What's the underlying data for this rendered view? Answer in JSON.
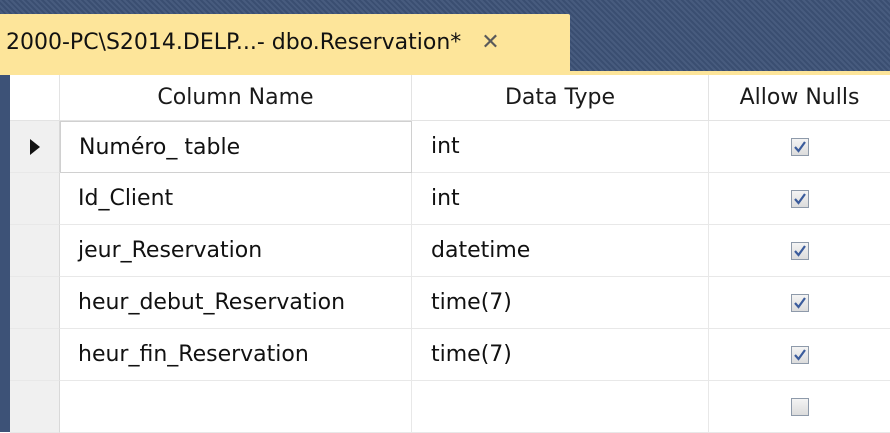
{
  "tab": {
    "title": "2000-PC\\S2014.DELP...- dbo.Reservation*",
    "close_glyph": "✕"
  },
  "columns": {
    "name": "Column Name",
    "type": "Data Type",
    "nulls": "Allow Nulls"
  },
  "rows": [
    {
      "name": "Numéro_ table",
      "type": "int",
      "allow_nulls": true,
      "current": true
    },
    {
      "name": "Id_Client",
      "type": "int",
      "allow_nulls": true,
      "current": false
    },
    {
      "name": "jeur_Reservation",
      "type": "datetime",
      "allow_nulls": true,
      "current": false
    },
    {
      "name": "heur_debut_Reservation",
      "type": "time(7)",
      "allow_nulls": true,
      "current": false
    },
    {
      "name": "heur_fin_Reservation",
      "type": "time(7)",
      "allow_nulls": true,
      "current": false
    },
    {
      "name": "",
      "type": "",
      "allow_nulls": false,
      "current": false
    }
  ],
  "colors": {
    "tab_active": "#fde59a",
    "frame": "#3d5277",
    "check": "#3b5c9c"
  }
}
